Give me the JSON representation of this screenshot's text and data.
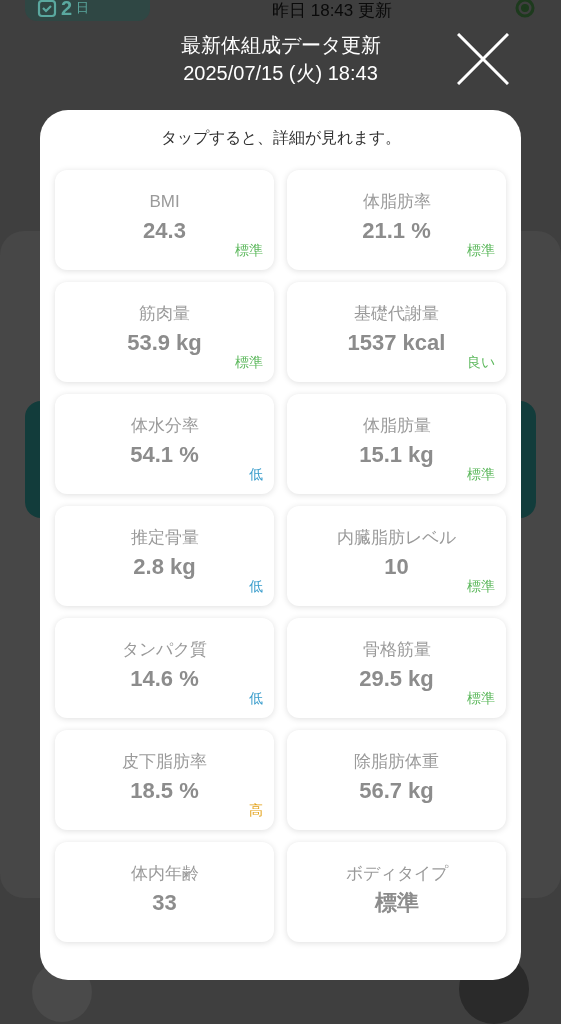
{
  "background": {
    "streak_badge": {
      "count": "2",
      "unit": "日"
    },
    "updated": "昨日 18:43 更新"
  },
  "dialog": {
    "title": "最新体組成データ更新",
    "date": "2025/07/15 (火) 18:43",
    "hint": "タップすると、詳細が見れます。",
    "metrics": [
      {
        "label": "BMI",
        "value": "24.3",
        "status": "標準",
        "color": "#5cb85c"
      },
      {
        "label": "体脂肪率",
        "value": "21.1 %",
        "status": "標準",
        "color": "#5cb85c"
      },
      {
        "label": "筋肉量",
        "value": "53.9 kg",
        "status": "標準",
        "color": "#5cb85c"
      },
      {
        "label": "基礎代謝量",
        "value": "1537 kcal",
        "status": "良い",
        "color": "#5cb85c"
      },
      {
        "label": "体水分率",
        "value": "54.1 %",
        "status": "低",
        "color": "#3a9dcc"
      },
      {
        "label": "体脂肪量",
        "value": "15.1 kg",
        "status": "標準",
        "color": "#5cb85c"
      },
      {
        "label": "推定骨量",
        "value": "2.8 kg",
        "status": "低",
        "color": "#3a9dcc"
      },
      {
        "label": "内臓脂肪レベル",
        "value": "10",
        "status": "標準",
        "color": "#5cb85c"
      },
      {
        "label": "タンパク質",
        "value": "14.6 %",
        "status": "低",
        "color": "#3a9dcc"
      },
      {
        "label": "骨格筋量",
        "value": "29.5 kg",
        "status": "標準",
        "color": "#5cb85c"
      },
      {
        "label": "皮下脂肪率",
        "value": "18.5 %",
        "status": "高",
        "color": "#e3a21a"
      },
      {
        "label": "除脂肪体重",
        "value": "56.7 kg"
      },
      {
        "label": "体内年齢",
        "value": "33"
      },
      {
        "label": "ボディタイプ",
        "value": "標準"
      }
    ]
  }
}
